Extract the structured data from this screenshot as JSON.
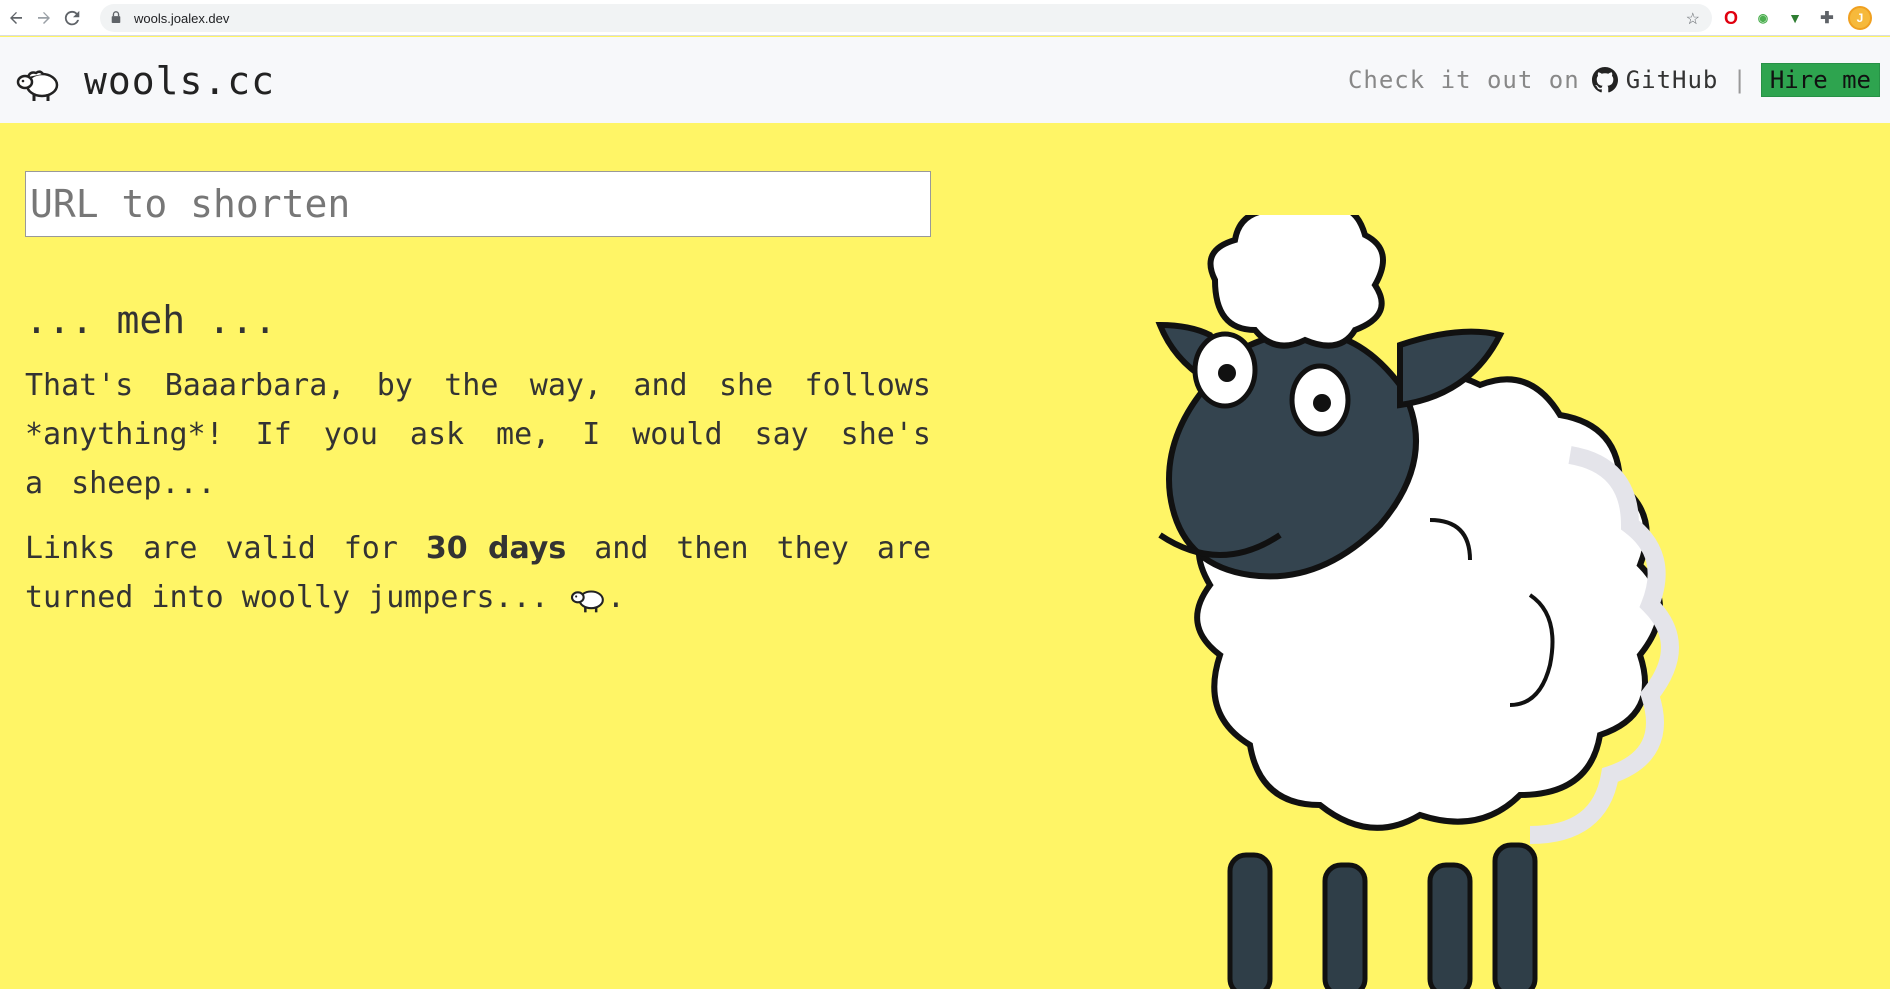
{
  "browser": {
    "url": "wools.joalex.dev"
  },
  "header": {
    "logo_text": "wools.cc",
    "checkout_text": "Check it out on",
    "github_label": "GitHub",
    "separator": "|",
    "hire_label": "Hire me"
  },
  "form": {
    "url_placeholder": "URL to shorten"
  },
  "content": {
    "meh": "... meh ...",
    "paragraph1": "That's Baaarbara, by the way, and she follows *anything*! If you ask me, I would say she's a sheep...",
    "p2_before": "Links are valid for ",
    "p2_bold": "30 days",
    "p2_after": " and then they are turned into woolly jumpers... ",
    "p2_end": "."
  },
  "colors": {
    "background": "#fff566",
    "header_bg": "#f7f8fa",
    "hire_button": "#2ea44f"
  }
}
